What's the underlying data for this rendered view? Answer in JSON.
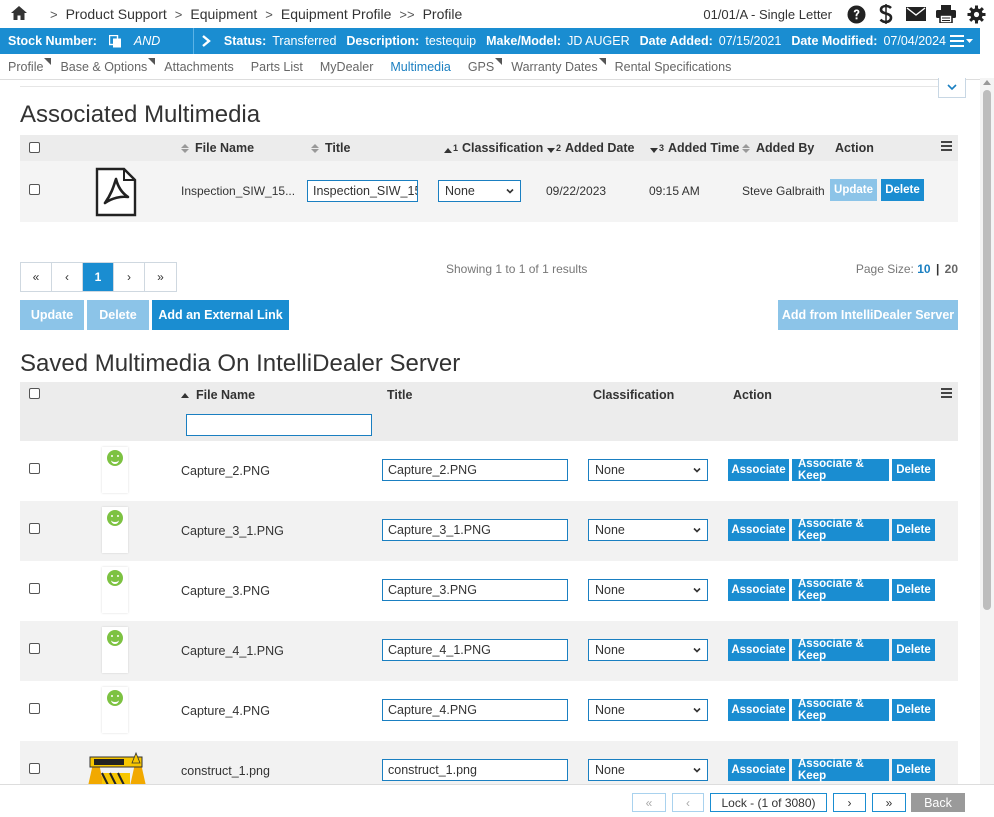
{
  "breadcrumb": {
    "items": [
      "Product Support",
      "Equipment",
      "Equipment Profile",
      "Profile"
    ],
    "separators": [
      ">",
      ">",
      ">",
      ">>"
    ]
  },
  "context": "01/01/A - Single Letter",
  "statusbar": {
    "stock_label": "Stock Number:",
    "stock_value": "AND",
    "status_label": "Status:",
    "status_value": "Transferred",
    "description_label": "Description:",
    "description_value": "testequip",
    "make_label": "Make/Model:",
    "make_value": "JD AUGER",
    "added_label": "Date Added:",
    "added_value": "07/15/2021",
    "modified_label": "Date Modified:",
    "modified_value": "07/04/2024"
  },
  "tabs": [
    {
      "label": "Profile"
    },
    {
      "label": "Base & Options"
    },
    {
      "label": "Attachments"
    },
    {
      "label": "Parts List"
    },
    {
      "label": "MyDealer"
    },
    {
      "label": "Multimedia"
    },
    {
      "label": "GPS"
    },
    {
      "label": "Warranty Dates"
    },
    {
      "label": "Rental Specifications"
    }
  ],
  "associated": {
    "title": "Associated Multimedia",
    "headers": {
      "file_name": "File Name",
      "title": "Title",
      "classification": "Classification",
      "classification_order": "1",
      "added_date": "Added Date",
      "added_date_order": "2",
      "added_time": "Added Time",
      "added_time_order": "3",
      "added_by": "Added By",
      "action": "Action"
    },
    "rows": [
      {
        "file_name": "Inspection_SIW_15...",
        "title": "Inspection_SIW_15",
        "classification": "None",
        "added_date": "09/22/2023",
        "added_time": "09:15 AM",
        "added_by": "Steve Galbraith",
        "update_label": "Update",
        "delete_label": "Delete"
      }
    ],
    "pager": {
      "first": "«",
      "prev": "‹",
      "current": "1",
      "next": "›",
      "last": "»"
    },
    "showing": "Showing 1 to 1 of 1 results",
    "page_size_label": "Page Size:",
    "page_size_selected": "10",
    "page_size_sep": "|",
    "page_size_alt": "20",
    "buttons": {
      "update": "Update",
      "delete": "Delete",
      "add_external": "Add an External Link",
      "add_server": "Add from IntelliDealer Server"
    }
  },
  "saved": {
    "title": "Saved Multimedia On IntelliDealer Server",
    "headers": {
      "file_name": "File Name",
      "title": "Title",
      "classification": "Classification",
      "action": "Action"
    },
    "filter_value": "",
    "action_labels": {
      "associate": "Associate",
      "associate_keep": "Associate & Keep",
      "delete": "Delete"
    },
    "rows": [
      {
        "file_name": "Capture_2.PNG",
        "title": "Capture_2.PNG",
        "classification": "None"
      },
      {
        "file_name": "Capture_3_1.PNG",
        "title": "Capture_3_1.PNG",
        "classification": "None"
      },
      {
        "file_name": "Capture_3.PNG",
        "title": "Capture_3.PNG",
        "classification": "None"
      },
      {
        "file_name": "Capture_4_1.PNG",
        "title": "Capture_4_1.PNG",
        "classification": "None"
      },
      {
        "file_name": "Capture_4.PNG",
        "title": "Capture_4.PNG",
        "classification": "None"
      },
      {
        "file_name": "construct_1.png",
        "title": "construct_1.png",
        "classification": "None"
      }
    ]
  },
  "footer": {
    "first": "«",
    "prev": "‹",
    "lock": "Lock - (1 of 3080)",
    "next": "›",
    "last": "»",
    "back": "Back"
  },
  "colors": {
    "accent": "#1a8dd1",
    "accent_disabled": "#8cc4e8",
    "header_bg": "#ececec",
    "row_alt": "#f2f2f2"
  }
}
